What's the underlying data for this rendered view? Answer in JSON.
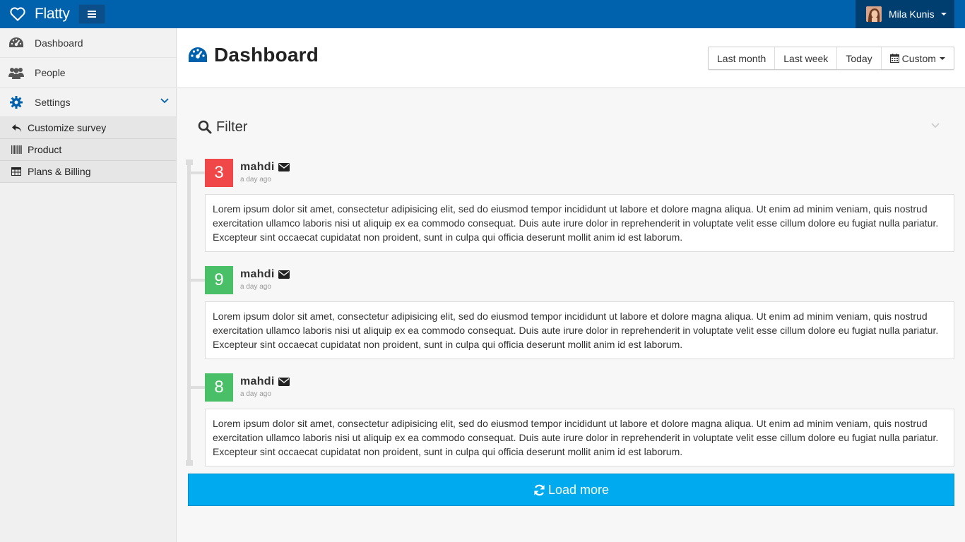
{
  "app": {
    "name": "Flatty",
    "brand_color": "#0061ad"
  },
  "user": {
    "name": "Mila Kunis"
  },
  "sidebar": {
    "items": [
      {
        "label": "Dashboard",
        "icon": "dashboard-icon"
      },
      {
        "label": "People",
        "icon": "people-icon"
      },
      {
        "label": "Settings",
        "icon": "gear-icon",
        "expanded": true
      }
    ],
    "subitems": [
      {
        "label": "Customize survey",
        "icon": "reply-icon"
      },
      {
        "label": "Product",
        "icon": "barcode-icon"
      },
      {
        "label": "Plans & Billing",
        "icon": "table-icon"
      }
    ]
  },
  "header": {
    "title": "Dashboard",
    "ranges": [
      "Last month",
      "Last week",
      "Today"
    ],
    "custom_label": "Custom"
  },
  "filter": {
    "label": "Filter"
  },
  "timeline": [
    {
      "count": "3",
      "color": "#f04848",
      "author": "mahdi",
      "time": "a day ago",
      "text": "Lorem ipsum dolor sit amet, consectetur adipisicing elit, sed do eiusmod tempor incididunt ut labore et dolore magna aliqua. Ut enim ad minim veniam, quis nostrud exercitation ullamco laboris nisi ut aliquip ex ea commodo consequat. Duis aute irure dolor in reprehenderit in voluptate velit esse cillum dolore eu fugiat nulla pariatur. Excepteur sint occaecat cupidatat non proident, sunt in culpa qui officia deserunt mollit anim id est laborum."
    },
    {
      "count": "9",
      "color": "#49bf67",
      "author": "mahdi",
      "time": "a day ago",
      "text": "Lorem ipsum dolor sit amet, consectetur adipisicing elit, sed do eiusmod tempor incididunt ut labore et dolore magna aliqua. Ut enim ad minim veniam, quis nostrud exercitation ullamco laboris nisi ut aliquip ex ea commodo consequat. Duis aute irure dolor in reprehenderit in voluptate velit esse cillum dolore eu fugiat nulla pariatur. Excepteur sint occaecat cupidatat non proident, sunt in culpa qui officia deserunt mollit anim id est laborum."
    },
    {
      "count": "8",
      "color": "#49bf67",
      "author": "mahdi",
      "time": "a day ago",
      "text": "Lorem ipsum dolor sit amet, consectetur adipisicing elit, sed do eiusmod tempor incididunt ut labore et dolore magna aliqua. Ut enim ad minim veniam, quis nostrud exercitation ullamco laboris nisi ut aliquip ex ea commodo consequat. Duis aute irure dolor in reprehenderit in voluptate velit esse cillum dolore eu fugiat nulla pariatur. Excepteur sint occaecat cupidatat non proident, sunt in culpa qui officia deserunt mollit anim id est laborum."
    }
  ],
  "load_more": {
    "label": "Load more",
    "color": "#00aaee"
  }
}
